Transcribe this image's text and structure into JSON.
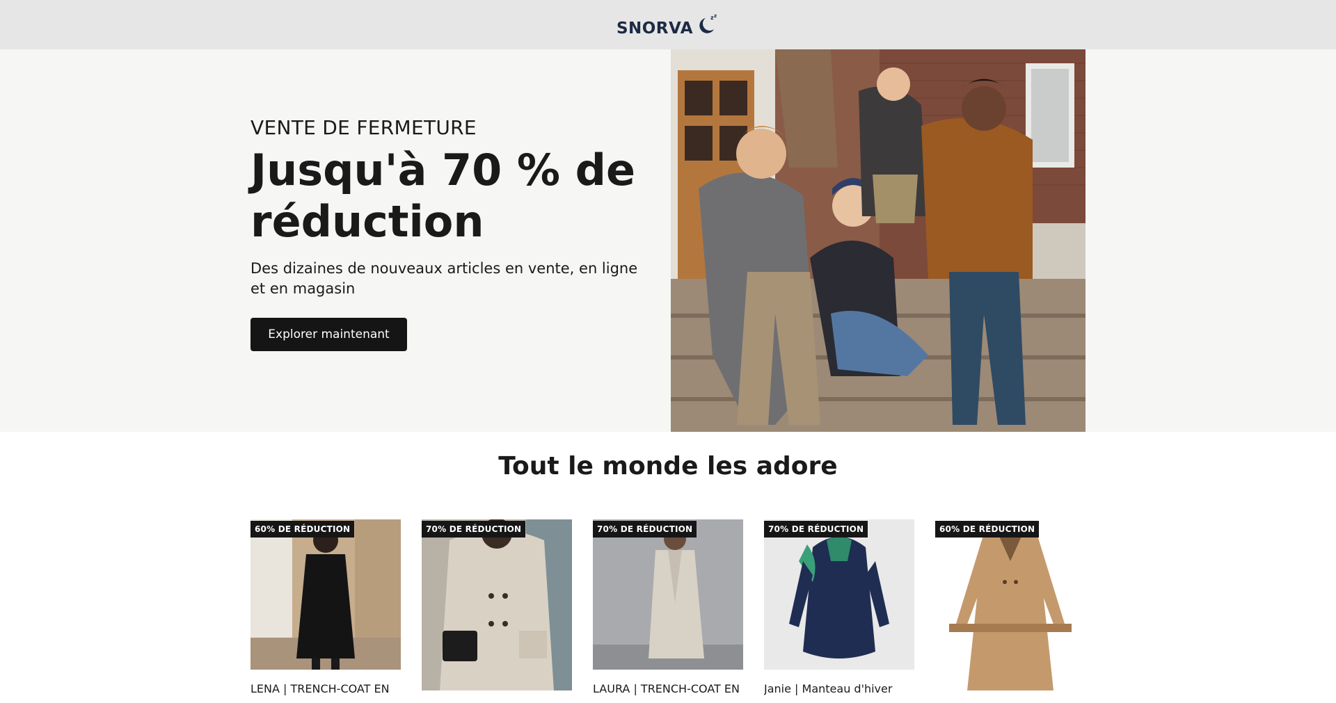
{
  "header": {
    "brand": "SNORVA",
    "logo_icon": "crescent-moon-zz-icon"
  },
  "hero": {
    "eyebrow": "VENTE DE FERMETURE",
    "headline": "Jusqu'à 70 % de réduction",
    "subline": "Des dizaines de nouveaux articles en vente, en ligne et en magasin",
    "cta_label": "Explorer maintenant"
  },
  "section": {
    "title": "Tout le monde les adore"
  },
  "products": [
    {
      "badge": "60% DE RÉDUCTION",
      "title": "LENA | TRENCH-COAT EN"
    },
    {
      "badge": "70% DE RÉDUCTION",
      "title": ""
    },
    {
      "badge": "70% DE RÉDUCTION",
      "title": "LAURA | TRENCH-COAT EN"
    },
    {
      "badge": "70% DE RÉDUCTION",
      "title": "Janie | Manteau d'hiver"
    },
    {
      "badge": "60% DE RÉDUCTION",
      "title": ""
    }
  ],
  "colors": {
    "header_bg": "#e6e6e6",
    "hero_bg": "#f6f6f4",
    "button_bg": "#151515",
    "badge_bg": "#161616",
    "brand_navy": "#1d2a44"
  }
}
